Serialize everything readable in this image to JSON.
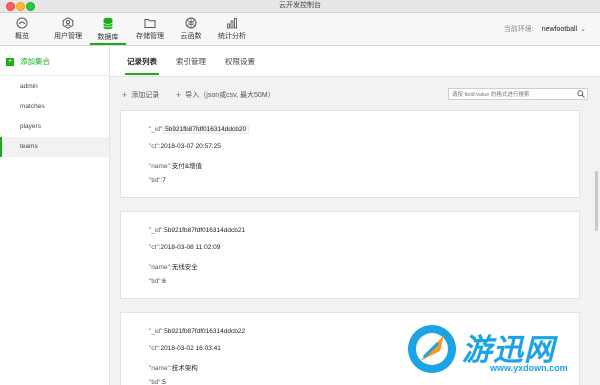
{
  "window": {
    "title": "云开发控制台"
  },
  "toolbar": {
    "items": [
      {
        "label": "概览",
        "icon": "gauge-icon"
      },
      {
        "label": "用户管理",
        "icon": "user-icon"
      },
      {
        "label": "数据库",
        "icon": "database-icon"
      },
      {
        "label": "存储管理",
        "icon": "folder-icon"
      },
      {
        "label": "云函数",
        "icon": "function-icon"
      },
      {
        "label": "统计分析",
        "icon": "chart-icon"
      }
    ],
    "active_index": 2,
    "env_label": "当前环境:",
    "env_value": "newfootball"
  },
  "sidebar": {
    "add_collection": "添加集合",
    "collections": [
      "admin",
      "matches",
      "players",
      "teams"
    ],
    "active": "teams"
  },
  "tabs": [
    "记录列表",
    "索引管理",
    "权限设置"
  ],
  "actions": {
    "add_record": "添加记录",
    "import": "导入（json或csv, 最大50M）",
    "search_placeholder": "请按 field:value 的格式进行搜索"
  },
  "records": [
    {
      "id": "5b921fb87fdf016314ddcb20",
      "ct": "2018-03-07 20:57:25",
      "name": "支付&增值",
      "tid": "7"
    },
    {
      "id": "5b921fb87fdf016314ddcb21",
      "ct": "2018-03-08 11:02:09",
      "name": "无线安全",
      "tid": "6"
    },
    {
      "id": "5b921fb87fdf016314ddcb22",
      "ct": "2018-03-02 16:03:41",
      "name": "技术架构",
      "tid": "5"
    }
  ],
  "field_keys": {
    "id": "\"_id\":",
    "ct": "\"ct\":",
    "name": "\"name\":",
    "tid": "\"tid\":"
  },
  "watermark": {
    "text": "游迅网",
    "url": "www.yxdown.com"
  },
  "colors": {
    "accent": "#1aad19",
    "watermark": "#1aa3e6"
  }
}
